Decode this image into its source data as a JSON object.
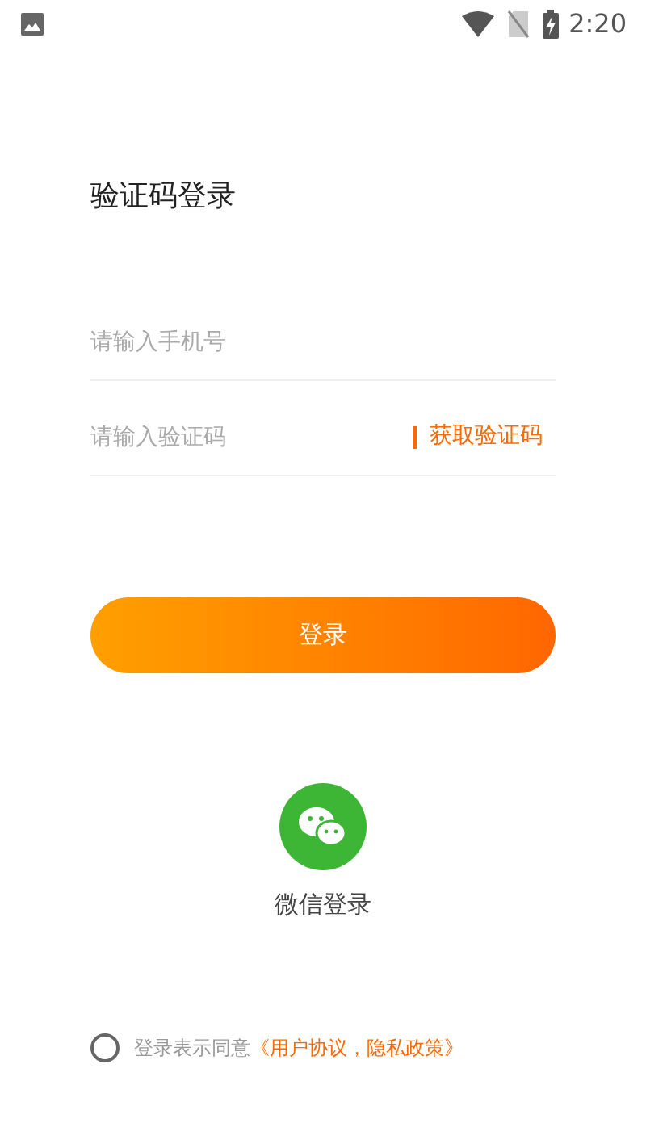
{
  "status_bar": {
    "time": "2:20"
  },
  "title": "验证码登录",
  "phone_field": {
    "placeholder": "请输入手机号"
  },
  "code_field": {
    "placeholder": "请输入验证码"
  },
  "get_code_link": "获取验证码",
  "login_button": "登录",
  "wechat_login": {
    "label": "微信登录"
  },
  "agreement": {
    "checked": false,
    "text": "登录表示同意",
    "link": "《用户协议，隐私政策》"
  }
}
